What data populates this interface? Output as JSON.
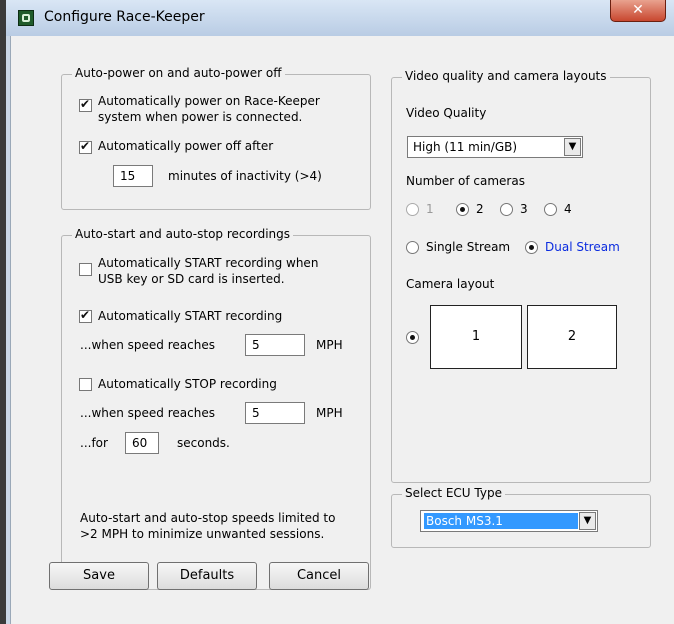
{
  "window": {
    "title": "Configure Race-Keeper",
    "close_icon": "✕"
  },
  "auto_power": {
    "group_title": "Auto-power on and auto-power off",
    "power_on": {
      "label_line1": "Automatically power on Race-Keeper",
      "label_line2": "system when power is connected.",
      "checked": true
    },
    "power_off": {
      "label": "Automatically power off after",
      "checked": true
    },
    "inactivity_minutes": "15",
    "inactivity_label": "minutes of inactivity (>4)"
  },
  "auto_record": {
    "group_title": "Auto-start and auto-stop recordings",
    "start_on_usb": {
      "label_line1": "Automatically START recording when",
      "label_line2": "USB key or SD card is inserted.",
      "checked": false
    },
    "start_on_speed": {
      "label": "Automatically START recording",
      "checked": true,
      "when_label": "...when speed reaches",
      "speed": "5",
      "unit": "MPH"
    },
    "stop_on_speed": {
      "label": "Automatically STOP recording",
      "checked": false,
      "when_label": "...when speed reaches",
      "speed": "5",
      "unit": "MPH",
      "for_label": "...for",
      "seconds": "60",
      "seconds_label": "seconds."
    },
    "note_line1": "Auto-start and auto-stop speeds limited to",
    "note_line2": ">2 MPH to minimize unwanted sessions."
  },
  "video": {
    "group_title": "Video quality and camera layouts",
    "quality_label": "Video Quality",
    "quality_value": "High (11 min/GB)",
    "num_cameras_label": "Number of cameras",
    "camera_options": [
      "1",
      "2",
      "3",
      "4"
    ],
    "selected_cameras": "2",
    "stream_single": "Single Stream",
    "stream_dual": "Dual Stream",
    "selected_stream": "Dual Stream",
    "layout_label": "Camera layout",
    "layout_cameras": [
      "1",
      "2"
    ]
  },
  "ecu": {
    "group_title": "Select ECU Type",
    "value": "Bosch MS3.1"
  },
  "buttons": {
    "save": "Save",
    "defaults": "Defaults",
    "cancel": "Cancel"
  },
  "icons": {
    "app": "race-keeper-app-icon",
    "dropdown_arrow": "▼"
  }
}
